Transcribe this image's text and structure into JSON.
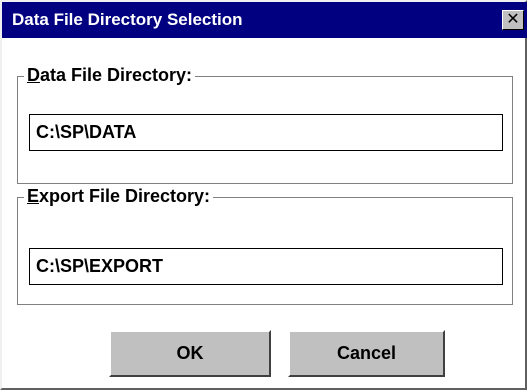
{
  "window": {
    "title": "Data File Directory Selection",
    "close_icon": "close-icon",
    "close_glyph": "✕"
  },
  "data_group": {
    "legend_mnemonic": "D",
    "legend_rest": "ata File Directory:",
    "value": "C:\\SP\\DATA"
  },
  "export_group": {
    "legend_mnemonic": "E",
    "legend_rest": "xport File Directory:",
    "value": "C:\\SP\\EXPORT"
  },
  "buttons": {
    "ok_label": "OK",
    "cancel_label": "Cancel"
  },
  "colors": {
    "titlebar": "#000080",
    "face": "#c0c0c0",
    "background": "#ffffff"
  }
}
